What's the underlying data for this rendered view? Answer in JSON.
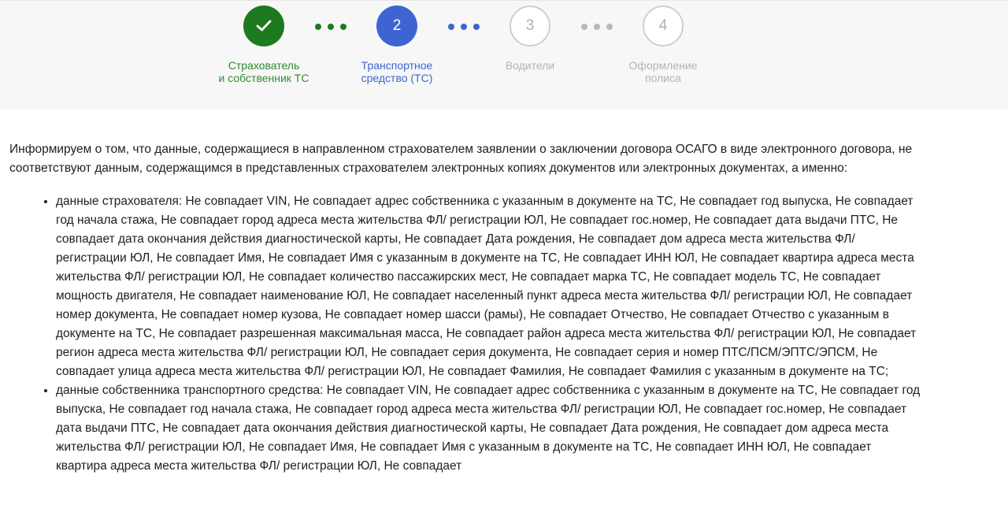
{
  "stepper": {
    "steps": [
      {
        "number": "✓",
        "label": "Страхователь\nи собственник ТС",
        "state": "done"
      },
      {
        "number": "2",
        "label": "Транспортное\nсредство (ТС)",
        "state": "active"
      },
      {
        "number": "3",
        "label": "Водители",
        "state": "pending"
      },
      {
        "number": "4",
        "label": "Оформление\nполиса",
        "state": "pending"
      }
    ]
  },
  "content": {
    "intro": "Информируем о том, что данные, содержащиеся в направленном страхователем заявлении о заключении договора ОСАГО в виде электронного договора, не соответствуют данным, содержащимся в представленных страхователем электронных копиях документов или электронных документах, а именно:",
    "items": [
      "данные страхователя: Не совпадает VIN, Не совпадает адрес собственника с указанным в документе на ТС, Не совпадает год выпуска, Не совпадает год начала стажа, Не совпадает город адреса места жительства ФЛ/ регистрации ЮЛ, Не совпадает гос.номер, Не совпадает дата выдачи ПТС, Не совпадает дата окончания действия диагностической карты, Не совпадает Дата рождения, Не совпадает дом адреса места жительства ФЛ/ регистрации ЮЛ, Не совпадает Имя, Не совпадает Имя с указанным в документе на ТС, Не совпадает ИНН ЮЛ, Не совпадает квартира адреса места жительства ФЛ/ регистрации ЮЛ, Не совпадает количество пассажирских мест, Не совпадает марка ТС, Не совпадает модель ТС, Не совпадает мощность двигателя, Не совпадает наименование ЮЛ, Не совпадает населенный пункт адреса места жительства ФЛ/ регистрации ЮЛ, Не совпадает номер документа, Не совпадает номер кузова, Не совпадает номер шасси (рамы), Не совпадает Отчество, Не совпадает Отчество с указанным в документе на ТС, Не совпадает разрешенная максимальная масса, Не совпадает район адреса места жительства ФЛ/ регистрации ЮЛ, Не совпадает регион адреса места жительства ФЛ/ регистрации ЮЛ, Не совпадает серия документа, Не совпадает серия и номер ПТС/ПСМ/ЭПТС/ЭПСМ, Не совпадает улица адреса места жительства ФЛ/ регистрации ЮЛ, Не совпадает Фамилия, Не совпадает Фамилия с указанным в документе на ТС;",
      "данные собственника транспортного средства: Не совпадает VIN, Не совпадает адрес собственника с указанным в документе на ТС, Не совпадает год выпуска, Не совпадает год начала стажа, Не совпадает город адреса места жительства ФЛ/ регистрации ЮЛ, Не совпадает гос.номер, Не совпадает дата выдачи ПТС, Не совпадает дата окончания действия диагностической карты, Не совпадает Дата рождения, Не совпадает дом адреса места жительства ФЛ/ регистрации ЮЛ, Не совпадает Имя, Не совпадает Имя с указанным в документе на ТС, Не совпадает ИНН ЮЛ, Не совпадает квартира адреса места жительства ФЛ/ регистрации ЮЛ, Не совпадает"
    ]
  },
  "colors": {
    "done": "#1e7a1e",
    "active": "#3e64d2",
    "pending": "#b3b3b3",
    "stepper_bg": "#f7f7f7"
  }
}
